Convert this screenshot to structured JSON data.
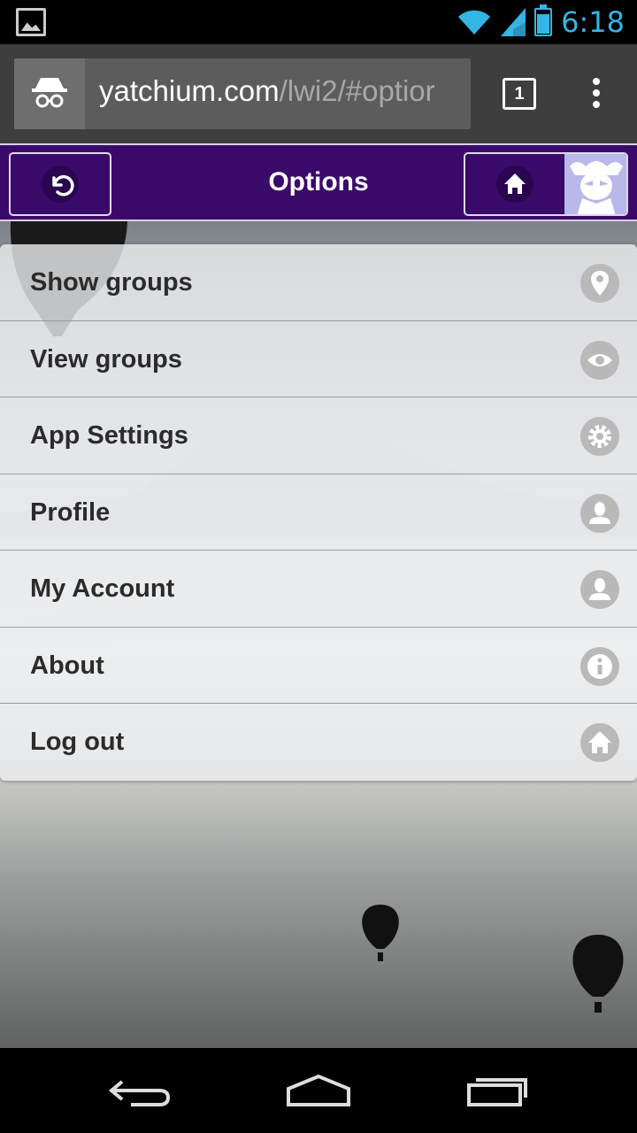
{
  "status_bar": {
    "time": "6:18",
    "icons": [
      "image-notification-icon",
      "wifi-icon",
      "signal-icon",
      "battery-icon"
    ],
    "accent_color": "#33b5e5"
  },
  "browser": {
    "url_host": "yatchium.com",
    "url_path": "/lwi2/#optior",
    "tab_count": "1",
    "icons": [
      "incognito-icon",
      "tabs-icon",
      "overflow-menu-icon"
    ]
  },
  "header": {
    "title": "Options",
    "color": "#3a0a6a",
    "icons": [
      "back-icon",
      "home-icon"
    ]
  },
  "menu": {
    "items": [
      {
        "label": "Show groups",
        "icon": "location-pin-icon"
      },
      {
        "label": "View groups",
        "icon": "eye-icon"
      },
      {
        "label": "App Settings",
        "icon": "gear-icon"
      },
      {
        "label": "Profile",
        "icon": "person-icon"
      },
      {
        "label": "My Account",
        "icon": "person-icon"
      },
      {
        "label": "About",
        "icon": "info-icon"
      },
      {
        "label": "Log out",
        "icon": "home-icon"
      }
    ]
  },
  "nav_bar": {
    "icons": [
      "nav-back-icon",
      "nav-home-icon",
      "nav-recents-icon"
    ]
  }
}
